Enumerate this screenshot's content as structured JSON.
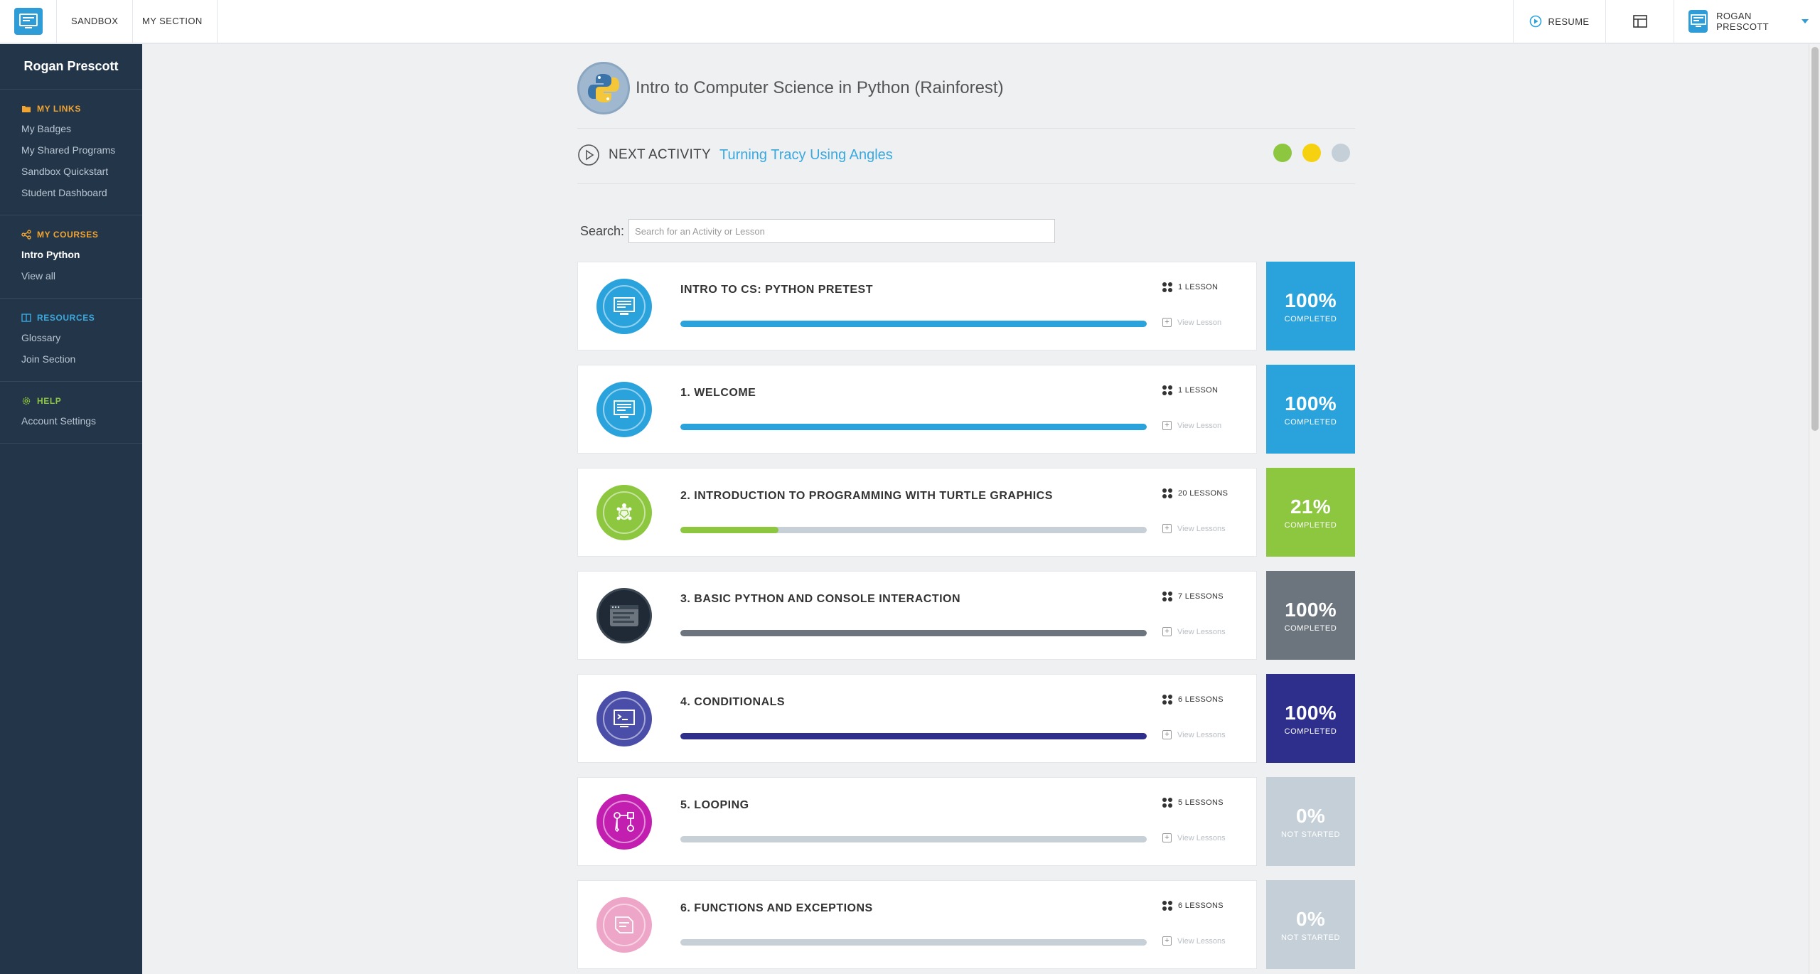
{
  "topbar": {
    "nav": [
      "SANDBOX",
      "MY SECTION"
    ],
    "resume_label": "RESUME",
    "user_name": "ROGAN PRESCOTT"
  },
  "sidebar": {
    "user_name": "Rogan Prescott",
    "sections": [
      {
        "title": "MY LINKS",
        "color": "#f2a431",
        "icon": "folder-icon",
        "items": [
          "My Badges",
          "My Shared Programs",
          "Sandbox Quickstart",
          "Student Dashboard"
        ]
      },
      {
        "title": "MY COURSES",
        "color": "#f2a431",
        "icon": "share-icon",
        "items": [
          "Intro Python",
          "View all"
        ],
        "active_index": 0
      },
      {
        "title": "RESOURCES",
        "color": "#3aa9e0",
        "icon": "book-icon",
        "items": [
          "Glossary",
          "Join Section"
        ]
      },
      {
        "title": "HELP",
        "color": "#8dc63f",
        "icon": "gear-icon",
        "items": [
          "Account Settings"
        ]
      }
    ]
  },
  "course": {
    "title": "Intro to Computer Science in Python (Rainforest)",
    "next_label": "NEXT ACTIVITY",
    "next_activity": "Turning Tracy Using Angles",
    "status_dots": [
      "#8dc63f",
      "#f5d10f",
      "#c5cfd8"
    ]
  },
  "search": {
    "label": "Search:",
    "placeholder": "Search for an Activity or Lesson"
  },
  "units": [
    {
      "title": "INTRO TO CS: PYTHON PRETEST",
      "lessons": "1 LESSON",
      "view": "View Lesson",
      "progress": 1.0,
      "percent": "100%",
      "status": "COMPLETED",
      "color": "#2aa3dd",
      "badge": "computer-icon"
    },
    {
      "title": "1. WELCOME",
      "lessons": "1 LESSON",
      "view": "View Lesson",
      "progress": 1.0,
      "percent": "100%",
      "status": "COMPLETED",
      "color": "#2aa3dd",
      "badge": "computer-icon"
    },
    {
      "title": "2. INTRODUCTION TO PROGRAMMING WITH TURTLE GRAPHICS",
      "lessons": "20 LESSONS",
      "view": "View Lessons",
      "progress": 0.21,
      "percent": "21%",
      "status": "COMPLETED",
      "color": "#8dc63f",
      "badge": "turtle-icon"
    },
    {
      "title": "3. BASIC PYTHON AND CONSOLE INTERACTION",
      "lessons": "7 LESSONS",
      "view": "View Lessons",
      "progress": 1.0,
      "percent": "100%",
      "status": "COMPLETED",
      "color": "#6c757d",
      "badge": "console-icon"
    },
    {
      "title": "4. CONDITIONALS",
      "lessons": "6 LESSONS",
      "view": "View Lessons",
      "progress": 1.0,
      "percent": "100%",
      "status": "COMPLETED",
      "color": "#2e2f8c",
      "badge": "terminal-icon"
    },
    {
      "title": "5. LOOPING",
      "lessons": "5 LESSONS",
      "view": "View Lessons",
      "progress": 0.0,
      "percent": "0%",
      "status": "NOT STARTED",
      "color": "#c5cfd8",
      "badge": "flowchart-icon",
      "badge_color": "#c21fb0"
    },
    {
      "title": "6. FUNCTIONS AND EXCEPTIONS",
      "lessons": "6 LESSONS",
      "view": "View Lessons",
      "progress": 0.0,
      "percent": "0%",
      "status": "NOT STARTED",
      "color": "#c5cfd8",
      "badge": "function-icon",
      "badge_color": "#eea6c8"
    }
  ]
}
